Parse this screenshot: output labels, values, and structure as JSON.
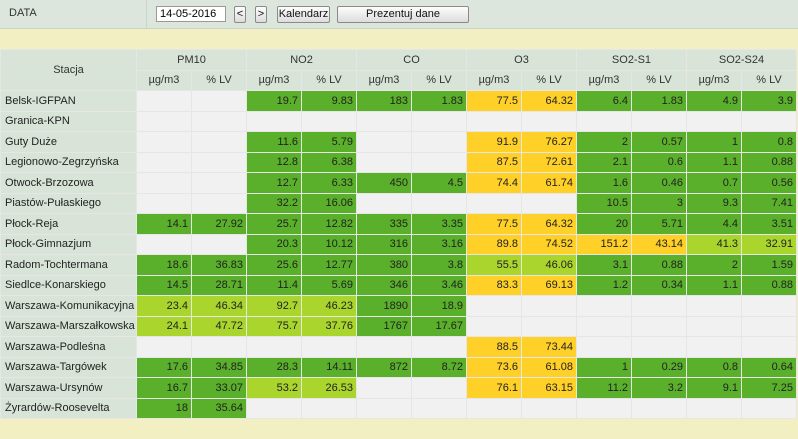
{
  "toolbar": {
    "data_label": "DATA",
    "date_value": "14-05-2016",
    "prev_label": "<",
    "next_label": ">",
    "calendar_label": "Kalendarz",
    "present_label": "Prezentuj dane"
  },
  "colors": {
    "none": "#f1f1f1",
    "very_good": "#5ab02a",
    "good": "#a9d52d",
    "moderate": "#ffd028",
    "header_bg": "#d8e4d8",
    "page_bg": "#f2efc2"
  },
  "table": {
    "station_header": "Stacja",
    "pollutants": [
      "PM10",
      "NO2",
      "CO",
      "O3",
      "SO2-S1",
      "SO2-S24"
    ],
    "unit_label": "µg/m3",
    "lv_label": "% LV",
    "rows": [
      {
        "station": "Belsk-IGFPAN",
        "cells": [
          [
            "",
            ""
          ],
          [
            "19.7",
            "9.83"
          ],
          [
            "183",
            "1.83"
          ],
          [
            "77.5",
            "64.32"
          ],
          [
            "6.4",
            "1.83"
          ],
          [
            "4.9",
            "3.9"
          ]
        ],
        "lvl": [
          "e",
          "g",
          "g",
          "y",
          "g",
          "g"
        ]
      },
      {
        "station": "Granica-KPN",
        "cells": [
          [
            "",
            ""
          ],
          [
            "",
            ""
          ],
          [
            "",
            ""
          ],
          [
            "",
            ""
          ],
          [
            "",
            ""
          ],
          [
            "",
            ""
          ]
        ],
        "lvl": [
          "e",
          "e",
          "e",
          "e",
          "e",
          "e"
        ]
      },
      {
        "station": "Guty Duże",
        "cells": [
          [
            "",
            ""
          ],
          [
            "11.6",
            "5.79"
          ],
          [
            "",
            ""
          ],
          [
            "91.9",
            "76.27"
          ],
          [
            "2",
            "0.57"
          ],
          [
            "1",
            "0.8"
          ]
        ],
        "lvl": [
          "e",
          "g",
          "e",
          "y",
          "g",
          "g"
        ]
      },
      {
        "station": "Legionowo-Zegrzyńska",
        "cells": [
          [
            "",
            ""
          ],
          [
            "12.8",
            "6.38"
          ],
          [
            "",
            ""
          ],
          [
            "87.5",
            "72.61"
          ],
          [
            "2.1",
            "0.6"
          ],
          [
            "1.1",
            "0.88"
          ]
        ],
        "lvl": [
          "e",
          "g",
          "e",
          "y",
          "g",
          "g"
        ]
      },
      {
        "station": "Otwock-Brzozowa",
        "cells": [
          [
            "",
            ""
          ],
          [
            "12.7",
            "6.33"
          ],
          [
            "450",
            "4.5"
          ],
          [
            "74.4",
            "61.74"
          ],
          [
            "1.6",
            "0.46"
          ],
          [
            "0.7",
            "0.56"
          ]
        ],
        "lvl": [
          "e",
          "g",
          "g",
          "y",
          "g",
          "g"
        ]
      },
      {
        "station": "Piastów-Pułaskiego",
        "cells": [
          [
            "",
            ""
          ],
          [
            "32.2",
            "16.06"
          ],
          [
            "",
            ""
          ],
          [
            "",
            ""
          ],
          [
            "10.5",
            "3"
          ],
          [
            "9.3",
            "7.41"
          ]
        ],
        "lvl": [
          "e",
          "g",
          "e",
          "e",
          "g",
          "g"
        ]
      },
      {
        "station": "Płock-Reja",
        "cells": [
          [
            "14.1",
            "27.92"
          ],
          [
            "25.7",
            "12.82"
          ],
          [
            "335",
            "3.35"
          ],
          [
            "77.5",
            "64.32"
          ],
          [
            "20",
            "5.71"
          ],
          [
            "4.4",
            "3.51"
          ]
        ],
        "lvl": [
          "g",
          "g",
          "g",
          "y",
          "g",
          "g"
        ]
      },
      {
        "station": "Płock-Gimnazjum",
        "cells": [
          [
            "",
            ""
          ],
          [
            "20.3",
            "10.12"
          ],
          [
            "316",
            "3.16"
          ],
          [
            "89.8",
            "74.52"
          ],
          [
            "151.2",
            "43.14"
          ],
          [
            "41.3",
            "32.91"
          ]
        ],
        "lvl": [
          "e",
          "g",
          "g",
          "y",
          "y",
          "l"
        ]
      },
      {
        "station": "Radom-Tochtermana",
        "cells": [
          [
            "18.6",
            "36.83"
          ],
          [
            "25.6",
            "12.77"
          ],
          [
            "380",
            "3.8"
          ],
          [
            "55.5",
            "46.06"
          ],
          [
            "3.1",
            "0.88"
          ],
          [
            "2",
            "1.59"
          ]
        ],
        "lvl": [
          "g",
          "g",
          "g",
          "l",
          "g",
          "g"
        ]
      },
      {
        "station": "Siedlce-Konarskiego",
        "cells": [
          [
            "14.5",
            "28.71"
          ],
          [
            "11.4",
            "5.69"
          ],
          [
            "346",
            "3.46"
          ],
          [
            "83.3",
            "69.13"
          ],
          [
            "1.2",
            "0.34"
          ],
          [
            "1.1",
            "0.88"
          ]
        ],
        "lvl": [
          "g",
          "g",
          "g",
          "y",
          "g",
          "g"
        ]
      },
      {
        "station": "Warszawa-Komunikacyjna",
        "cells": [
          [
            "23.4",
            "46.34"
          ],
          [
            "92.7",
            "46.23"
          ],
          [
            "1890",
            "18.9"
          ],
          [
            "",
            ""
          ],
          [
            "",
            ""
          ],
          [
            "",
            ""
          ]
        ],
        "lvl": [
          "l",
          "l",
          "g",
          "e",
          "e",
          "e"
        ]
      },
      {
        "station": "Warszawa-Marszałkowska",
        "cells": [
          [
            "24.1",
            "47.72"
          ],
          [
            "75.7",
            "37.76"
          ],
          [
            "1767",
            "17.67"
          ],
          [
            "",
            ""
          ],
          [
            "",
            ""
          ],
          [
            "",
            ""
          ]
        ],
        "lvl": [
          "l",
          "l",
          "g",
          "e",
          "e",
          "e"
        ]
      },
      {
        "station": "Warszawa-Podleśna",
        "cells": [
          [
            "",
            ""
          ],
          [
            "",
            ""
          ],
          [
            "",
            ""
          ],
          [
            "88.5",
            "73.44"
          ],
          [
            "",
            ""
          ],
          [
            "",
            ""
          ]
        ],
        "lvl": [
          "e",
          "e",
          "e",
          "y",
          "e",
          "e"
        ]
      },
      {
        "station": "Warszawa-Targówek",
        "cells": [
          [
            "17.6",
            "34.85"
          ],
          [
            "28.3",
            "14.11"
          ],
          [
            "872",
            "8.72"
          ],
          [
            "73.6",
            "61.08"
          ],
          [
            "1",
            "0.29"
          ],
          [
            "0.8",
            "0.64"
          ]
        ],
        "lvl": [
          "g",
          "g",
          "g",
          "y",
          "g",
          "g"
        ]
      },
      {
        "station": "Warszawa-Ursynów",
        "cells": [
          [
            "16.7",
            "33.07"
          ],
          [
            "53.2",
            "26.53"
          ],
          [
            "",
            ""
          ],
          [
            "76.1",
            "63.15"
          ],
          [
            "11.2",
            "3.2"
          ],
          [
            "9.1",
            "7.25"
          ]
        ],
        "lvl": [
          "g",
          "l",
          "e",
          "y",
          "g",
          "g"
        ]
      },
      {
        "station": "Żyrardów-Roosevelta",
        "cells": [
          [
            "18",
            "35.64"
          ],
          [
            "",
            ""
          ],
          [
            "",
            ""
          ],
          [
            "",
            ""
          ],
          [
            "",
            ""
          ],
          [
            "",
            ""
          ]
        ],
        "lvl": [
          "g",
          "e",
          "e",
          "e",
          "e",
          "e"
        ]
      }
    ]
  }
}
